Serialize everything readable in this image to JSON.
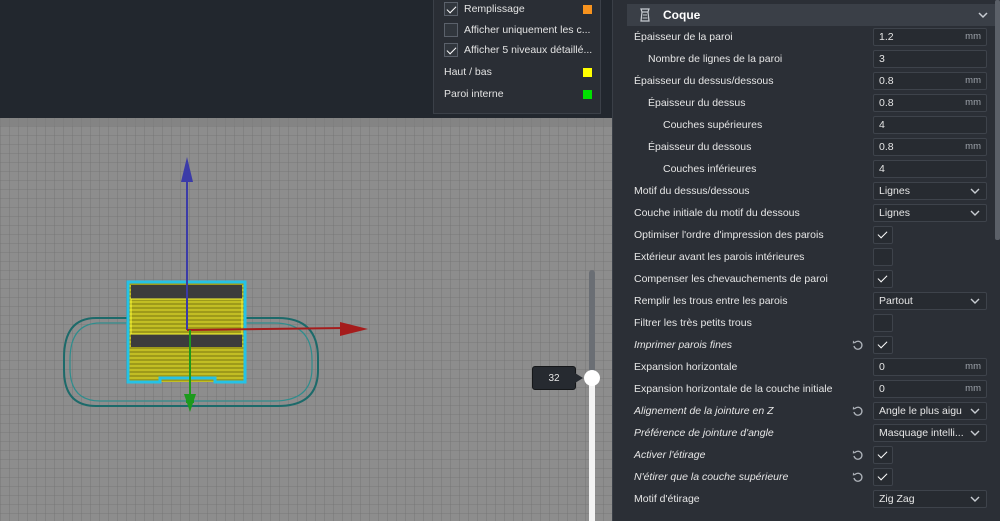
{
  "legend": {
    "items": [
      {
        "label": "Remplissage",
        "checkbox": true,
        "checked": true,
        "swatch": "#f7931e"
      },
      {
        "label": "Afficher uniquement les c...",
        "checkbox": true,
        "checked": false
      },
      {
        "label": "Afficher 5 niveaux détaillé...",
        "checkbox": true,
        "checked": true
      },
      {
        "label": "Haut / bas",
        "checkbox": false,
        "swatch": "#ffff00"
      },
      {
        "label": "Paroi interne",
        "checkbox": false,
        "swatch": "#00e000"
      }
    ]
  },
  "layer_slider": {
    "value": "32"
  },
  "settings": {
    "section_title": "Coque",
    "rows": [
      {
        "label": "Épaisseur de la paroi",
        "indent": 0,
        "type": "number",
        "value": "1.2",
        "unit": "mm"
      },
      {
        "label": "Nombre de lignes de la paroi",
        "indent": 1,
        "type": "number",
        "value": "3",
        "unit": ""
      },
      {
        "label": "Épaisseur du dessus/dessous",
        "indent": 0,
        "type": "number",
        "value": "0.8",
        "unit": "mm"
      },
      {
        "label": "Épaisseur du dessus",
        "indent": 1,
        "type": "number",
        "value": "0.8",
        "unit": "mm"
      },
      {
        "label": "Couches supérieures",
        "indent": 2,
        "type": "number",
        "value": "4",
        "unit": ""
      },
      {
        "label": "Épaisseur du dessous",
        "indent": 1,
        "type": "number",
        "value": "0.8",
        "unit": "mm"
      },
      {
        "label": "Couches inférieures",
        "indent": 2,
        "type": "number",
        "value": "4",
        "unit": ""
      },
      {
        "label": "Motif du dessus/dessous",
        "indent": 0,
        "type": "dropdown",
        "value": "Lignes"
      },
      {
        "label": "Couche initiale du motif du dessous",
        "indent": 0,
        "type": "dropdown",
        "value": "Lignes"
      },
      {
        "label": "Optimiser l'ordre d'impression des parois",
        "indent": 0,
        "type": "check",
        "checked": true
      },
      {
        "label": "Extérieur avant les parois intérieures",
        "indent": 0,
        "type": "check",
        "checked": false
      },
      {
        "label": "Compenser les chevauchements de paroi",
        "indent": 0,
        "type": "check",
        "checked": true
      },
      {
        "label": "Remplir les trous entre les parois",
        "indent": 0,
        "type": "dropdown",
        "value": "Partout"
      },
      {
        "label": "Filtrer les très petits trous",
        "indent": 0,
        "type": "check",
        "checked": false
      },
      {
        "label": "Imprimer parois fines",
        "indent": 0,
        "italic": true,
        "reset": true,
        "type": "check",
        "checked": true
      },
      {
        "label": "Expansion horizontale",
        "indent": 0,
        "type": "number",
        "value": "0",
        "unit": "mm"
      },
      {
        "label": "Expansion horizontale de la couche initiale",
        "indent": 0,
        "type": "number",
        "value": "0",
        "unit": "mm"
      },
      {
        "label": "Alignement de la jointure en Z",
        "indent": 0,
        "italic": true,
        "reset": true,
        "type": "dropdown",
        "value": "Angle le plus aigu"
      },
      {
        "label": "Préférence de jointure d'angle",
        "indent": 0,
        "italic": true,
        "type": "dropdown",
        "value": "Masquage intelli..."
      },
      {
        "label": "Activer l'étirage",
        "indent": 0,
        "italic": true,
        "reset": true,
        "type": "check",
        "checked": true
      },
      {
        "label": "N'étirer que la couche supérieure",
        "indent": 0,
        "italic": true,
        "reset": true,
        "type": "check",
        "checked": true
      },
      {
        "label": "Motif d'étirage",
        "indent": 0,
        "type": "dropdown",
        "value": "Zig Zag"
      }
    ]
  }
}
